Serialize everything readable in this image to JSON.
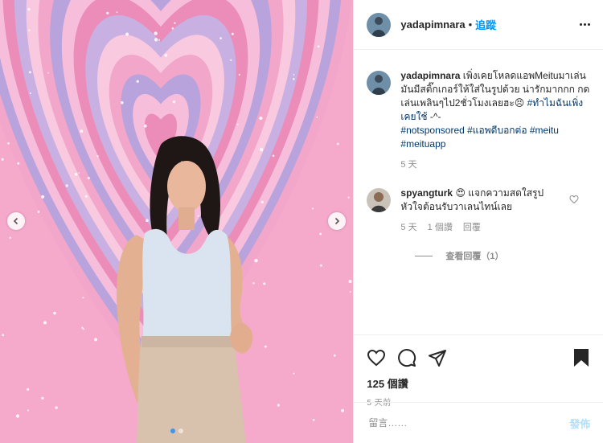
{
  "media": {
    "image_alt": "Woman in white tank top and beige trousers in front of pink and purple concentric heart pattern background",
    "carousel_dots": 2,
    "active_dot": 0
  },
  "header": {
    "username": "yadapimnara",
    "separator": "•",
    "follow_label": "追蹤"
  },
  "caption": {
    "username": "yadapimnara",
    "text": "เพิ่งเคยโหลดแอพMeituมาเล่น มันมีสติ๊กเกอร์ให้ใส่ในรูปด้วย น่ารักมากกก กดเล่นเพลินๆไป2ชั่วโมงเลยฮะ😣 ",
    "hashtag_1": "#ทำไมฉันเพิ่งเคยใช้",
    "text_2": " -^-",
    "hashtags": "#notsponsored #แอพดีบอกต่อ #meitu #meituapp",
    "time": "5 天"
  },
  "comment": {
    "username": "spyangturk",
    "emoji": "😍",
    "text": "แจกความสดใสรูปหัวใจต้อนรับวาเลนไทน์เลย",
    "time": "5 天",
    "likes": "1 個讚",
    "reply_label": "回覆",
    "view_replies": "查看回覆（1）"
  },
  "actions": {
    "likes_count": "125 個讚",
    "posted_time": "5 天前"
  },
  "add_comment": {
    "placeholder": "留言……",
    "post_label": "發佈"
  },
  "colors": {
    "accent": "#0095f6",
    "link": "#00376b",
    "muted": "#8e8e8e",
    "post_disabled": "#b2dffc"
  }
}
